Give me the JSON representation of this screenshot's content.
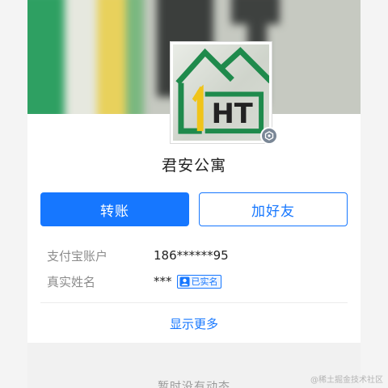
{
  "profile": {
    "avatar_text": "HT",
    "name": "君安公寓"
  },
  "actions": {
    "transfer_label": "转账",
    "add_friend_label": "加好友"
  },
  "info": {
    "account_label": "支付宝账户",
    "account_value": "186******95",
    "realname_label": "真实姓名",
    "realname_value": "***",
    "realname_tag": "已实名"
  },
  "show_more_label": "显示更多",
  "feed": {
    "empty_text": "暂时没有动态"
  },
  "watermark": "@稀土掘金技术社区",
  "colors": {
    "accent": "#1677ff",
    "logo_green": "#1f8a4c",
    "logo_yellow": "#f0c419"
  }
}
